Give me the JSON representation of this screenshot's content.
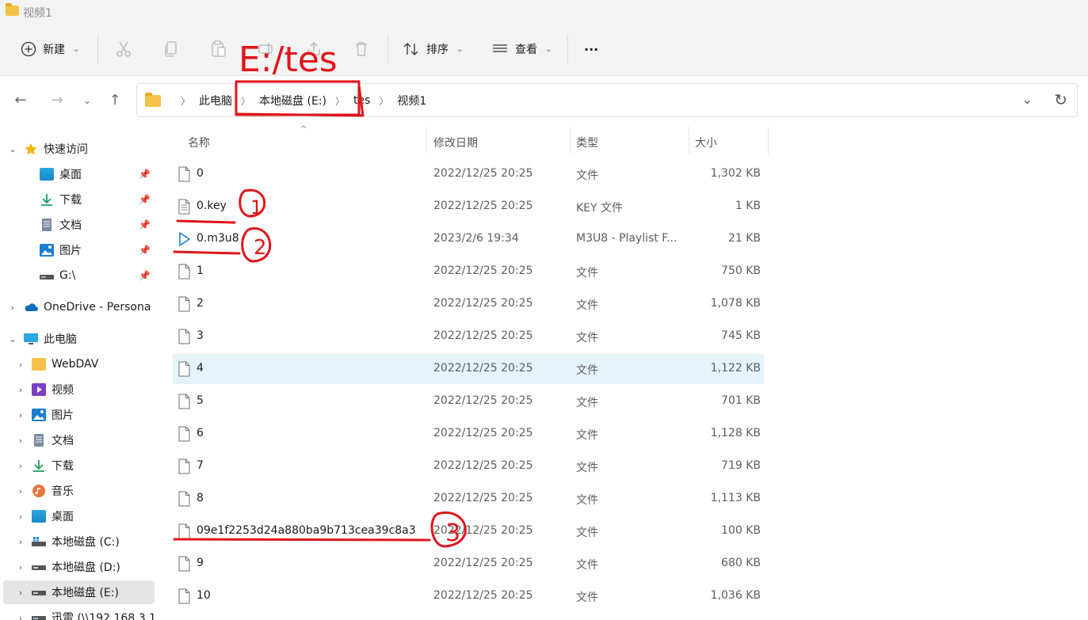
{
  "window": {
    "title": "视频1"
  },
  "toolbar": {
    "new_label": "新建",
    "sort_label": "排序",
    "view_label": "查看",
    "more_label": "···"
  },
  "address": {
    "crumbs": [
      "此电脑",
      "本地磁盘 (E:)",
      "tes",
      "视频1"
    ]
  },
  "sidebar": {
    "quick_access": "快速访问",
    "quick_items": [
      "桌面",
      "下载",
      "文档",
      "图片",
      "G:\\"
    ],
    "onedrive": "OneDrive - Persona",
    "this_pc": "此电脑",
    "pc_items": [
      "WebDAV",
      "视频",
      "图片",
      "文档",
      "下载",
      "音乐",
      "桌面",
      "本地磁盘 (C:)",
      "本地磁盘 (D:)",
      "本地磁盘 (E:)",
      "迅雷 (\\\\192.168.3.1"
    ]
  },
  "columns": {
    "name": "名称",
    "date": "修改日期",
    "type": "类型",
    "size": "大小"
  },
  "files": [
    {
      "name": "0",
      "date": "2022/12/25 20:25",
      "type": "文件",
      "size": "1,302 KB",
      "icon": "blank-file-icon"
    },
    {
      "name": "0.key",
      "date": "2022/12/25 20:25",
      "type": "KEY 文件",
      "size": "1 KB",
      "icon": "text-file-icon"
    },
    {
      "name": "0.m3u8",
      "date": "2023/2/6 19:34",
      "type": "M3U8 - Playlist F...",
      "size": "21 KB",
      "icon": "play-icon"
    },
    {
      "name": "1",
      "date": "2022/12/25 20:25",
      "type": "文件",
      "size": "750 KB",
      "icon": "blank-file-icon"
    },
    {
      "name": "2",
      "date": "2022/12/25 20:25",
      "type": "文件",
      "size": "1,078 KB",
      "icon": "blank-file-icon"
    },
    {
      "name": "3",
      "date": "2022/12/25 20:25",
      "type": "文件",
      "size": "745 KB",
      "icon": "blank-file-icon"
    },
    {
      "name": "4",
      "date": "2022/12/25 20:25",
      "type": "文件",
      "size": "1,122 KB",
      "icon": "blank-file-icon"
    },
    {
      "name": "5",
      "date": "2022/12/25 20:25",
      "type": "文件",
      "size": "701 KB",
      "icon": "blank-file-icon"
    },
    {
      "name": "6",
      "date": "2022/12/25 20:25",
      "type": "文件",
      "size": "1,128 KB",
      "icon": "blank-file-icon"
    },
    {
      "name": "7",
      "date": "2022/12/25 20:25",
      "type": "文件",
      "size": "719 KB",
      "icon": "blank-file-icon"
    },
    {
      "name": "8",
      "date": "2022/12/25 20:25",
      "type": "文件",
      "size": "1,113 KB",
      "icon": "blank-file-icon"
    },
    {
      "name": "09e1f2253d24a880ba9b713cea39c8a3",
      "date": "2022/12/25 20:25",
      "type": "文件",
      "size": "100 KB",
      "icon": "blank-file-icon"
    },
    {
      "name": "9",
      "date": "2022/12/25 20:25",
      "type": "文件",
      "size": "680 KB",
      "icon": "blank-file-icon"
    },
    {
      "name": "10",
      "date": "2022/12/25 20:25",
      "type": "文件",
      "size": "1,036 KB",
      "icon": "blank-file-icon"
    }
  ],
  "annotations": {
    "path_note": "E:/tes",
    "marks": [
      "1",
      "2",
      "3"
    ],
    "color": "#e0151b"
  }
}
